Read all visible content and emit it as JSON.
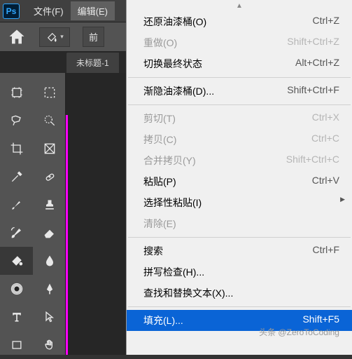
{
  "app": {
    "logo": "Ps"
  },
  "menubar": {
    "file": "文件(F)",
    "edit": "编辑(E)"
  },
  "options": {
    "foreground_btn": "前"
  },
  "tabs": {
    "doc1": "未标题-1"
  },
  "watermark": "头条 @ZeroToCoding",
  "edit_menu": {
    "undo": {
      "label": "还原油漆桶(O)",
      "shortcut": "Ctrl+Z"
    },
    "redo": {
      "label": "重做(O)",
      "shortcut": "Shift+Ctrl+Z"
    },
    "toggle": {
      "label": "切换最终状态",
      "shortcut": "Alt+Ctrl+Z"
    },
    "fade": {
      "label": "渐隐油漆桶(D)...",
      "shortcut": "Shift+Ctrl+F"
    },
    "cut": {
      "label": "剪切(T)",
      "shortcut": "Ctrl+X"
    },
    "copy": {
      "label": "拷贝(C)",
      "shortcut": "Ctrl+C"
    },
    "copymerge": {
      "label": "合并拷贝(Y)",
      "shortcut": "Shift+Ctrl+C"
    },
    "paste": {
      "label": "粘贴(P)",
      "shortcut": "Ctrl+V"
    },
    "pastesp": {
      "label": "选择性粘贴(I)",
      "shortcut": ""
    },
    "clear": {
      "label": "清除(E)",
      "shortcut": ""
    },
    "search": {
      "label": "搜索",
      "shortcut": "Ctrl+F"
    },
    "spell": {
      "label": "拼写检查(H)...",
      "shortcut": ""
    },
    "findrep": {
      "label": "查找和替换文本(X)...",
      "shortcut": ""
    },
    "fill": {
      "label": "填充(L)...",
      "shortcut": "Shift+F5"
    }
  }
}
